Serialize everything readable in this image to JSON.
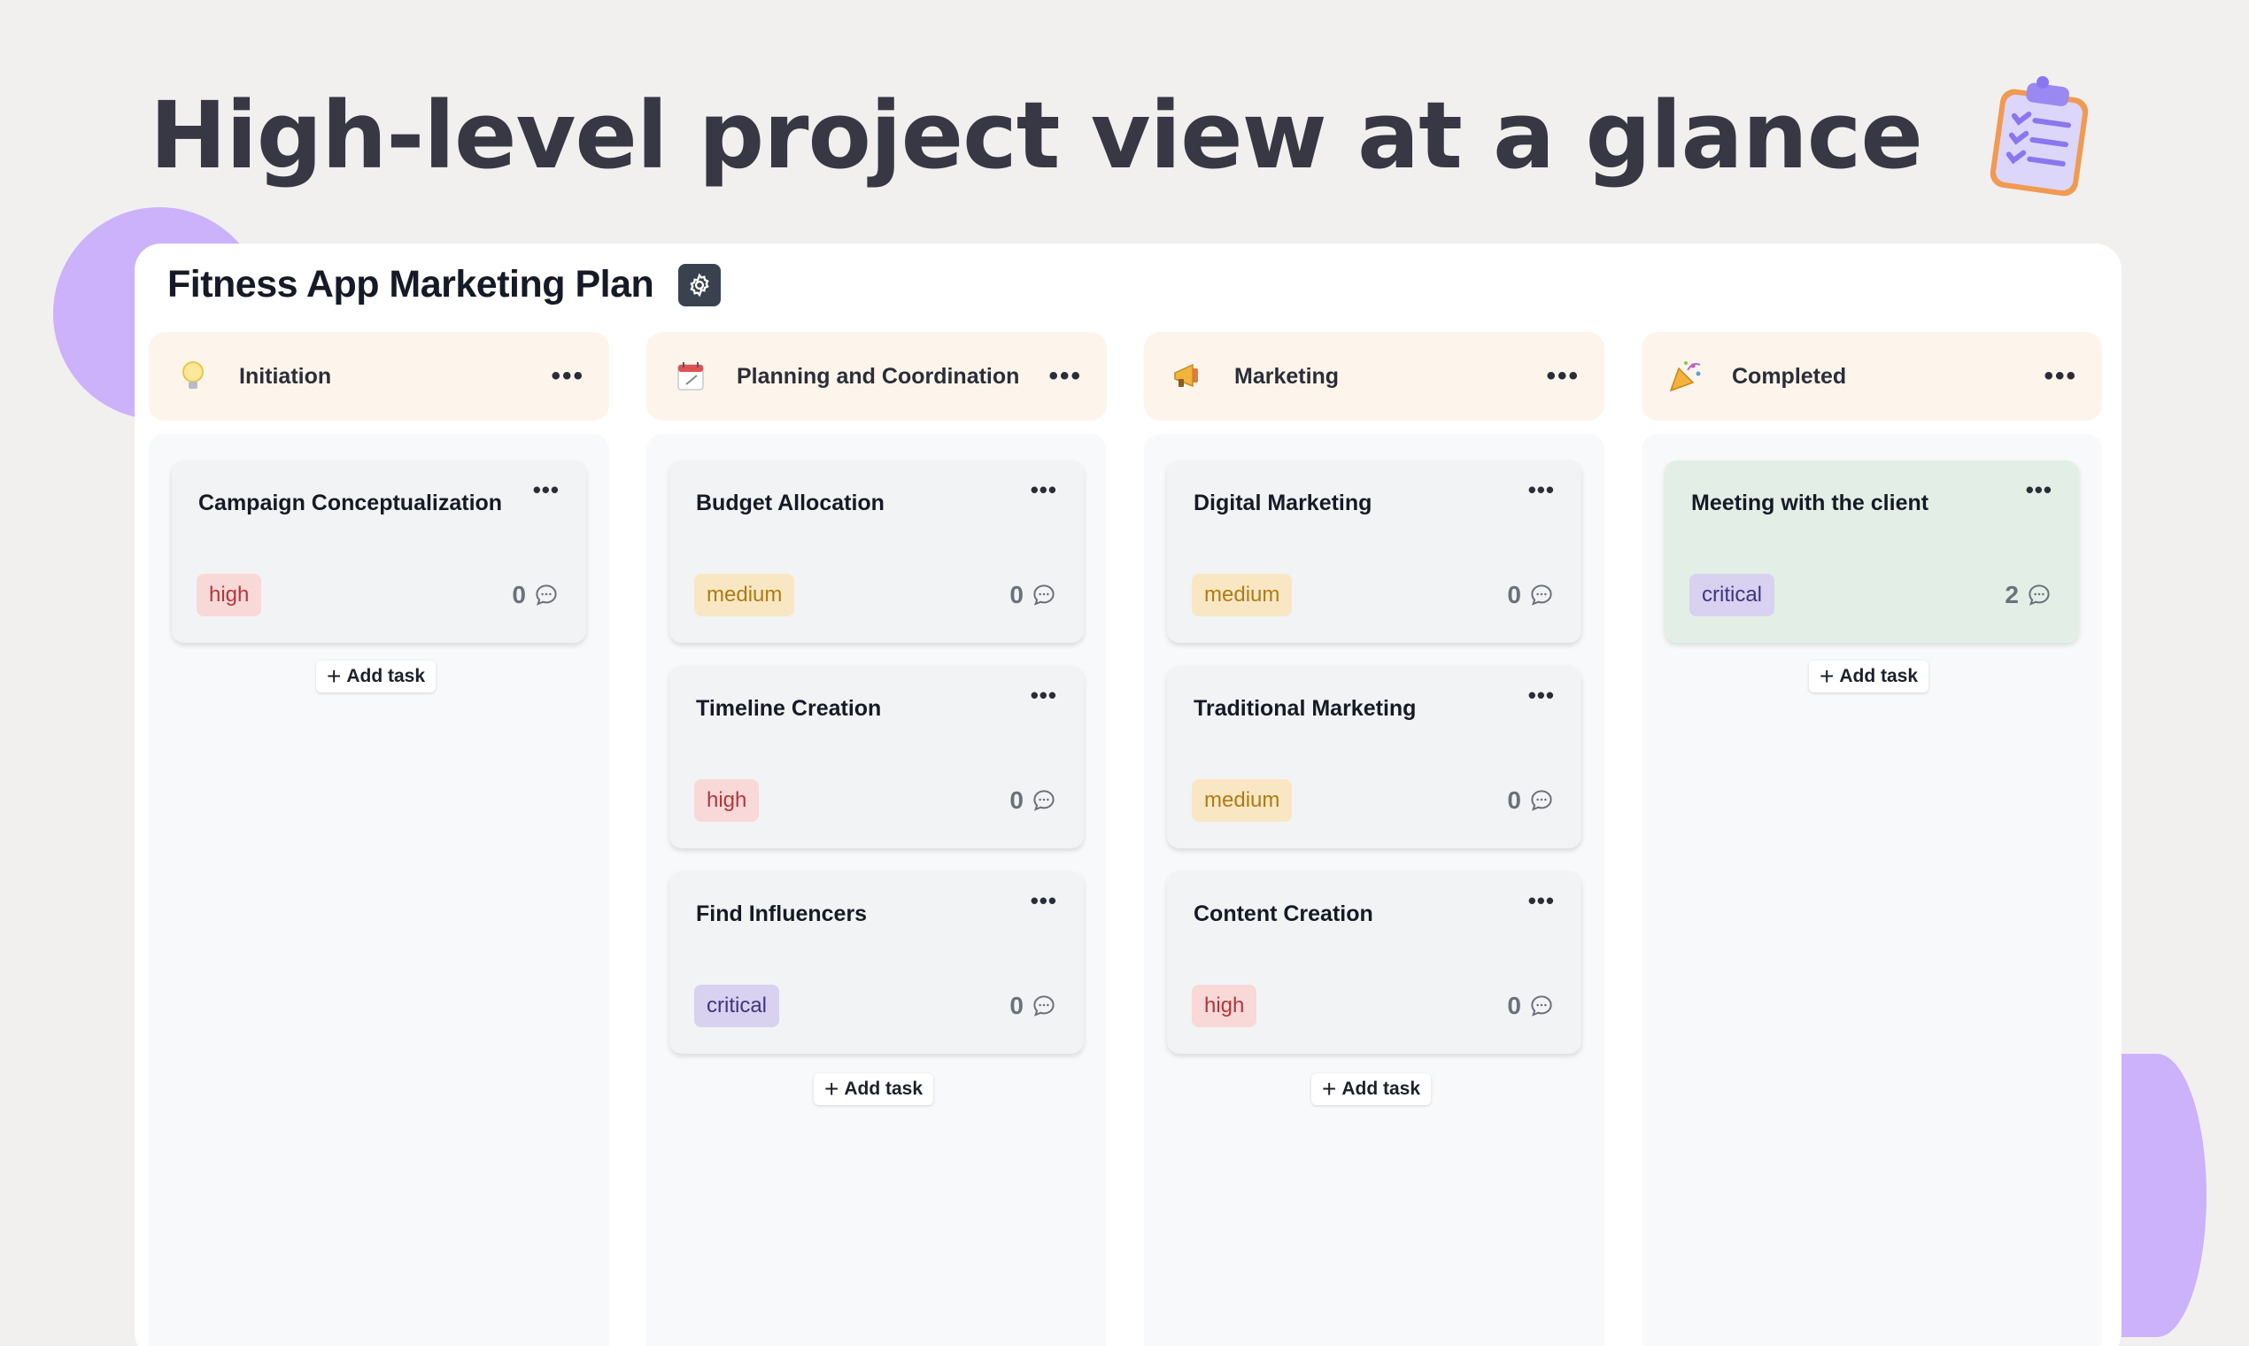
{
  "hero": {
    "title": "High-level project view at a glance",
    "icon": "clipboard-checklist-icon"
  },
  "board": {
    "title": "Fitness App Marketing Plan",
    "settings_icon": "gear-icon"
  },
  "columns": [
    {
      "title": "Initiation",
      "icon": "lightbulb-icon",
      "add_label": "Add task",
      "cards": [
        {
          "title": "Campaign Conceptualization",
          "priority": "high",
          "comments": "0"
        }
      ]
    },
    {
      "title": "Planning and Coordination",
      "icon": "calendar-icon",
      "add_label": "Add task",
      "cards": [
        {
          "title": "Budget Allocation",
          "priority": "medium",
          "comments": "0"
        },
        {
          "title": "Timeline Creation",
          "priority": "high",
          "comments": "0"
        },
        {
          "title": "Find Influencers",
          "priority": "critical",
          "comments": "0"
        }
      ]
    },
    {
      "title": "Marketing",
      "icon": "megaphone-icon",
      "add_label": "Add task",
      "cards": [
        {
          "title": "Digital Marketing",
          "priority": "medium",
          "comments": "0"
        },
        {
          "title": "Traditional Marketing",
          "priority": "medium",
          "comments": "0"
        },
        {
          "title": "Content Creation",
          "priority": "high",
          "comments": "0"
        }
      ]
    },
    {
      "title": "Completed",
      "icon": "party-popper-icon",
      "add_label": "Add task",
      "cards": [
        {
          "title": "Meeting with the client",
          "priority": "critical",
          "comments": "2"
        }
      ]
    }
  ],
  "colors": {
    "background": "#f1f0ef",
    "accent_blob": "#cbb2fb",
    "column_header": "#fdf5eb",
    "completed_card": "#e3efe6",
    "high": "#f9d8d8",
    "medium": "#f9e7c4",
    "critical": "#d8d1ef"
  }
}
